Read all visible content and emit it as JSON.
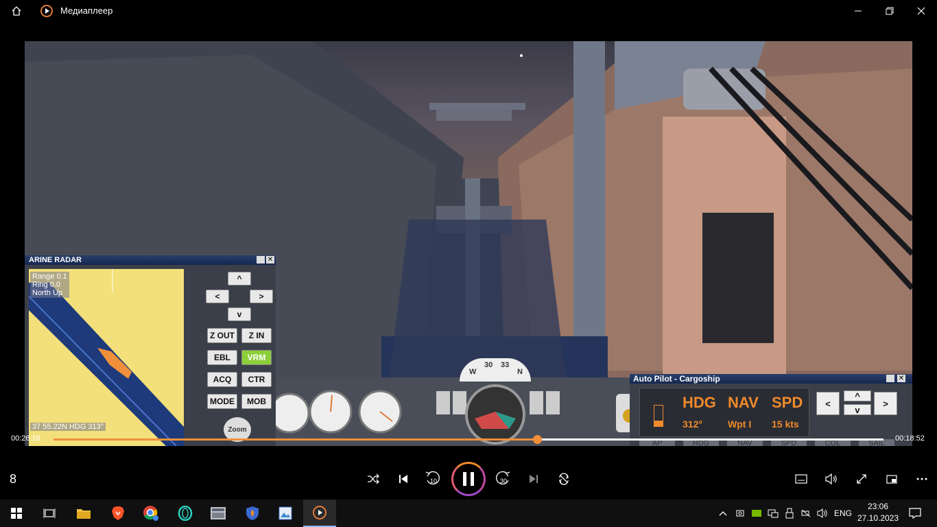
{
  "window": {
    "title": "Медиаплеер",
    "home_icon": "home-icon",
    "app_icon": "media-player-icon",
    "controls": [
      "minimize-icon",
      "restore-icon",
      "close-icon"
    ]
  },
  "radar": {
    "title": "ARINE RADAR",
    "range": "Range 0.1",
    "ring": "Ring 0.0",
    "mode": "North Up",
    "position": "37 55.22N HDG 313°",
    "buttons": {
      "up": "^",
      "left": "<",
      "right": ">",
      "down": "v",
      "zoom_out": "Z OUT",
      "zoom_in": "Z IN",
      "ebl": "EBL",
      "vrm": "VRM",
      "acq": "ACQ",
      "ctr": "CTR",
      "mode": "MODE",
      "mob": "MOB"
    },
    "zoom_label": "Zoom",
    "colors": {
      "screen": "#f3e07a",
      "channel": "#1e3a7a",
      "active": "#8ccf3a"
    }
  },
  "gauges": {
    "compass_labels": [
      "W",
      "30",
      "33",
      "N"
    ]
  },
  "autopilot": {
    "title": "Auto Pilot - Cargoship",
    "hdg_label": "HDG",
    "nav_label": "NAV",
    "spd_label": "SPD",
    "hdg_value": "312°",
    "nav_value": "Wpt I",
    "spd_value": "15 kts",
    "tabs": [
      "AP",
      "HDG",
      "NAV",
      "SPD",
      "COL",
      "SAIL"
    ],
    "accent": "#f08a2a"
  },
  "player": {
    "elapsed": "00:26:16",
    "remaining": "00:18:52",
    "progress": 0.583,
    "left_label": "8",
    "skip_back": "10",
    "skip_forward": "30",
    "buttons": [
      "shuffle-icon",
      "previous-icon",
      "skip-back-10-icon",
      "pause-icon",
      "skip-forward-30-icon",
      "next-icon",
      "repeat-icon",
      "subtitles-icon",
      "volume-icon",
      "fullscreen-icon",
      "mini-player-icon",
      "more-icon"
    ],
    "accent": "#f0903a"
  },
  "taskbar": {
    "apps": [
      "windows-start-icon",
      "task-view-icon",
      "file-explorer-icon",
      "brave-icon",
      "chrome-icon",
      "opera-icon",
      "app-icon",
      "firewall-icon",
      "image-viewer-icon",
      "media-player-icon"
    ],
    "language": "ENG",
    "time": "23:06",
    "date": "27.10.2023"
  }
}
